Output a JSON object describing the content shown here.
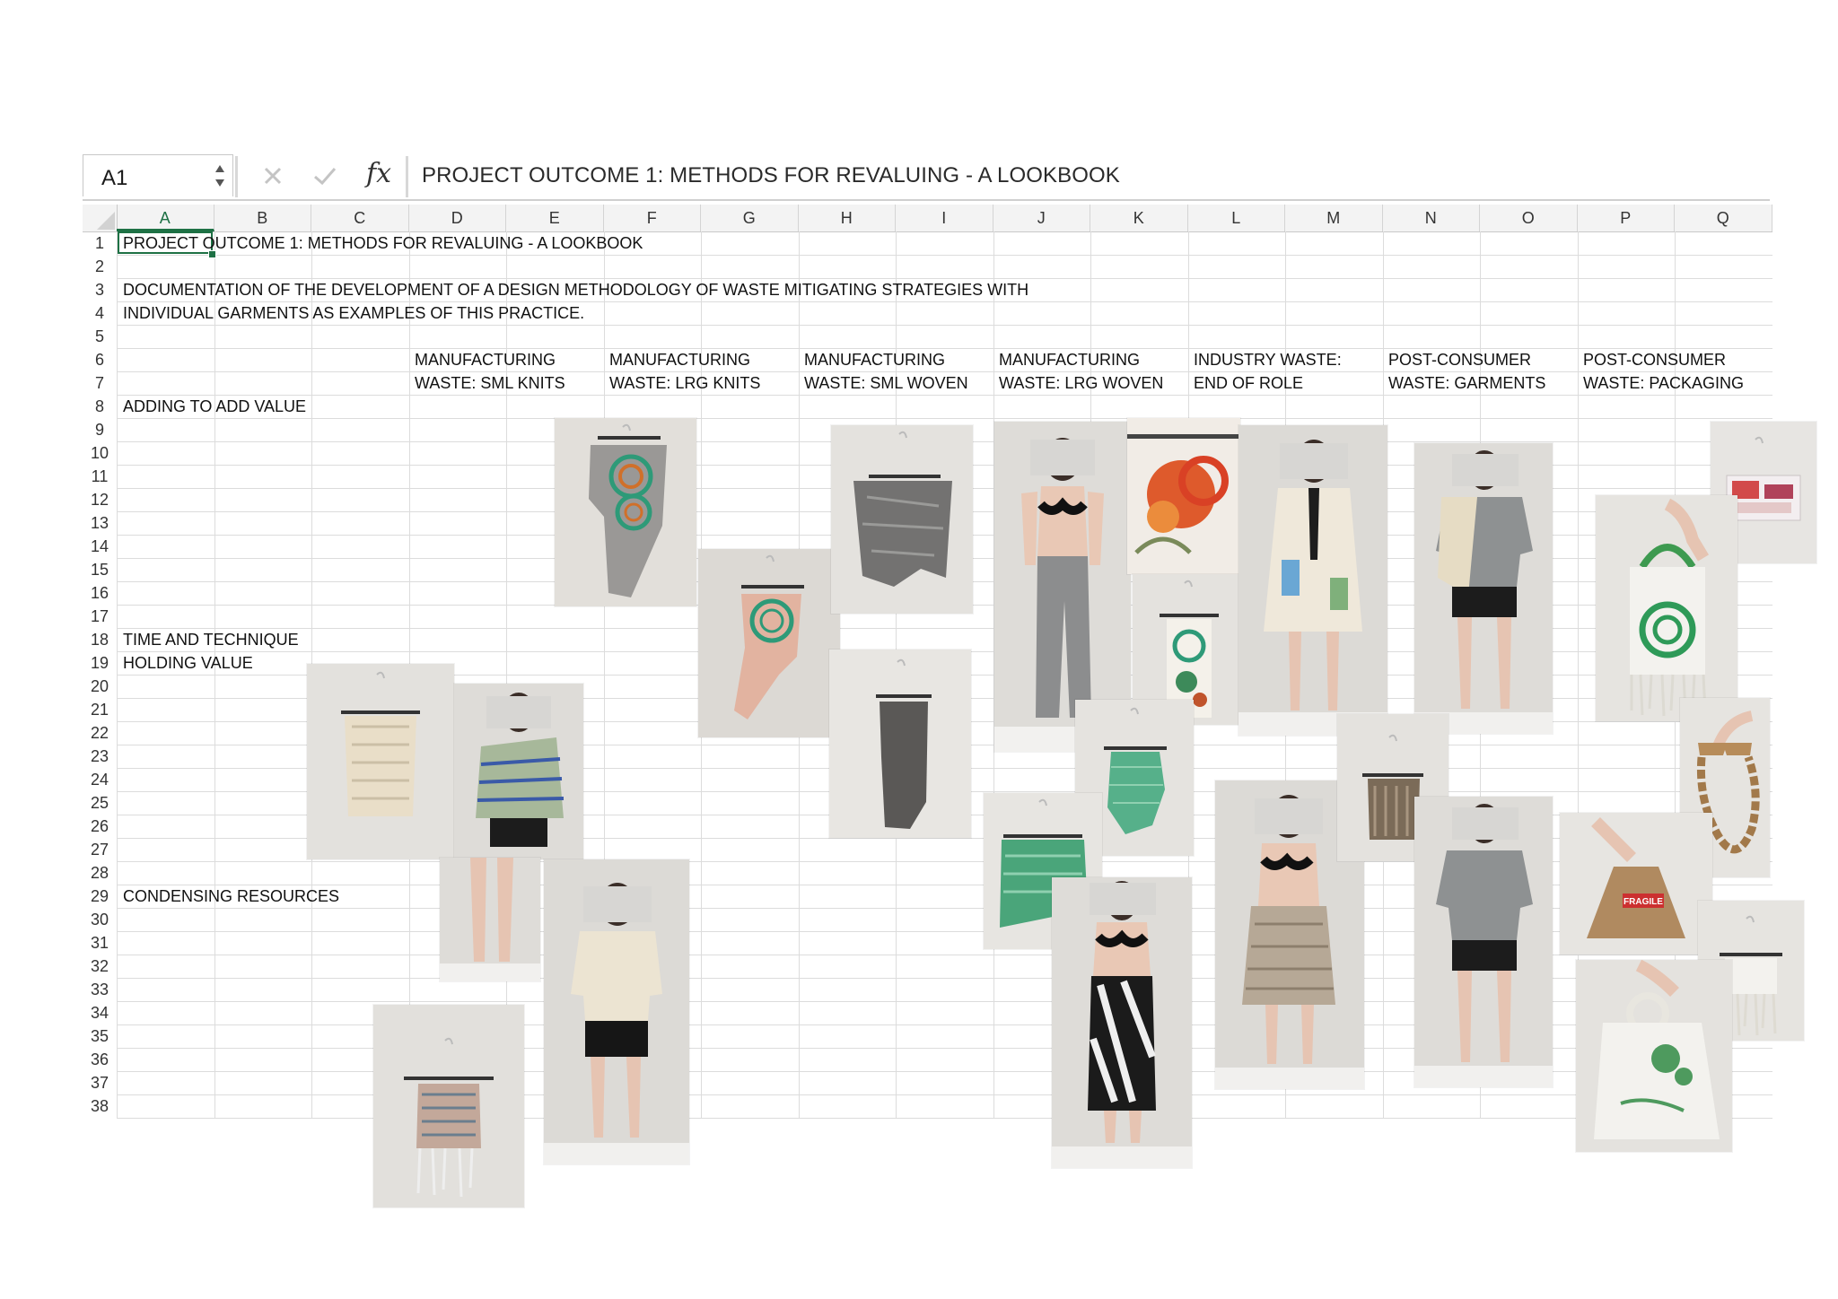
{
  "formula_bar": {
    "cell_reference": "A1",
    "fx_label": "fx",
    "content": "PROJECT OUTCOME 1: METHODS FOR REVALUING - A LOOKBOOK"
  },
  "columns": [
    "A",
    "B",
    "C",
    "D",
    "E",
    "F",
    "G",
    "H",
    "I",
    "J",
    "K",
    "L",
    "M",
    "N",
    "O",
    "P",
    "Q"
  ],
  "rows": [
    "1",
    "2",
    "3",
    "4",
    "5",
    "6",
    "7",
    "8",
    "9",
    "10",
    "11",
    "12",
    "13",
    "14",
    "15",
    "16",
    "17",
    "18",
    "19",
    "20",
    "21",
    "22",
    "23",
    "24",
    "25",
    "26",
    "27",
    "28",
    "29",
    "30",
    "31",
    "32",
    "33",
    "34",
    "35",
    "36",
    "37",
    "38"
  ],
  "cells": {
    "a1": "PROJECT OUTCOME 1: METHODS FOR REVALUING - A LOOKBOOK",
    "a3": "DOCUMENTATION OF THE DEVELOPMENT OF A DESIGN METHODOLOGY OF WASTE MITIGATING STRATEGIES WITH",
    "a4": "INDIVIDUAL GARMENTS AS EXAMPLES OF THIS PRACTICE.",
    "d6": "MANUFACTURING",
    "d7": "WASTE: SML KNITS",
    "f6": "MANUFACTURING",
    "f7": "WASTE: LRG KNITS",
    "h6": "MANUFACTURING",
    "h7": "WASTE: SML WOVEN",
    "j6": "MANUFACTURING",
    "j7": "WASTE: LRG WOVEN",
    "l6": "INDUSTRY WASTE:",
    "l7": "END OF ROLE",
    "n6": "POST-CONSUMER",
    "n7": "WASTE: GARMENTS",
    "p6": "POST-CONSUMER",
    "p7": "WASTE: PACKAGING",
    "a8": "ADDING TO ADD VALUE",
    "a18": "TIME AND TECHNIQUE",
    "a19": "HOLDING VALUE",
    "a29": "CONDENSING RESOURCES"
  },
  "photos": [
    {
      "name": "grey-skirt-green-spiral",
      "subject": "garment-on-hanger"
    },
    {
      "name": "pink-skirt-green-spiral",
      "subject": "garment-on-hanger"
    },
    {
      "name": "grey-crinkled-top",
      "subject": "garment-on-hanger"
    },
    {
      "name": "grey-knit-strip",
      "subject": "garment-on-hanger"
    },
    {
      "name": "model-grey-patchwork-trousers",
      "subject": "model"
    },
    {
      "name": "orange-floral-fabric",
      "subject": "fabric"
    },
    {
      "name": "floral-panel-on-hanger",
      "subject": "garment-on-hanger"
    },
    {
      "name": "model-cream-coat",
      "subject": "model"
    },
    {
      "name": "model-knit-shrug-grey-tee",
      "subject": "model"
    },
    {
      "name": "plastic-tray",
      "subject": "object"
    },
    {
      "name": "green-spiral-tote",
      "subject": "object"
    },
    {
      "name": "cream-smocked-top",
      "subject": "garment-on-hanger"
    },
    {
      "name": "model-striped-knit-top",
      "subject": "model"
    },
    {
      "name": "model-cream-twisted-top",
      "subject": "model"
    },
    {
      "name": "woven-multicolour-top",
      "subject": "garment-on-hanger"
    },
    {
      "name": "green-gingham-top",
      "subject": "garment-on-hanger"
    },
    {
      "name": "green-smocked-top",
      "subject": "garment-on-hanger"
    },
    {
      "name": "model-black-white-skirt",
      "subject": "model"
    },
    {
      "name": "model-beige-smocked-skirt",
      "subject": "model"
    },
    {
      "name": "brown-knit-panel",
      "subject": "garment-on-hanger"
    },
    {
      "name": "model-grey-tee-shorts",
      "subject": "model"
    },
    {
      "name": "cardboard-glasses-chain",
      "subject": "object"
    },
    {
      "name": "fragile-box-bag",
      "subject": "object",
      "label": "FRAGILE"
    },
    {
      "name": "white-woven-fringe",
      "subject": "garment-on-hanger"
    },
    {
      "name": "plastic-carrier-bag",
      "subject": "object"
    }
  ],
  "colors": {
    "accent_green": "#1e7145",
    "grid_line": "#dcdcdc",
    "header_bg": "#f3f3f3"
  }
}
